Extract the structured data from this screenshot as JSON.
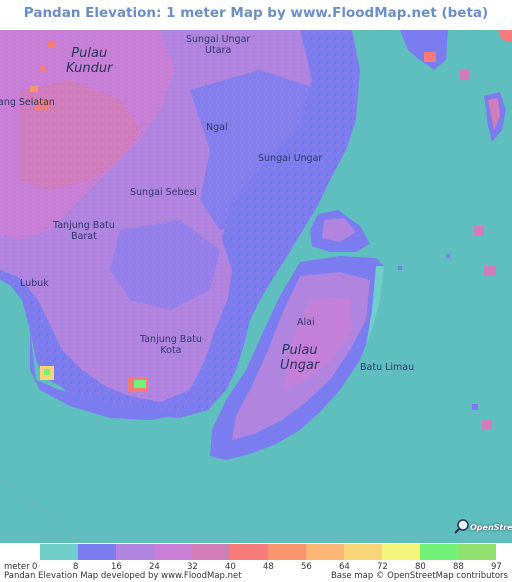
{
  "title": "Pandan Elevation: 1 meter Map by www.FloodMap.net (beta)",
  "map_labels": {
    "pulau_kundur": "Pulau\nKundur",
    "sungai_ungar_utara": "Sungai Ungar\nUtara",
    "selatan": "ang Selatan",
    "ngal": "Ngal",
    "sungai_ungar": "Sungai Ungar",
    "sungai_sebesi": "Sungai Sebesi",
    "tanjung_batu_barat": "Tanjung Batu\nBarat",
    "lubuk": "Lubuk",
    "tanjung_batu_kota": "Tanjung Batu\nKota",
    "alai": "Alai",
    "pulau_ungar": "Pulau\nUngar",
    "batu_limau": "Batu Limau"
  },
  "legend": {
    "unit": "meter",
    "ticks": [
      "0",
      "8",
      "16",
      "24",
      "32",
      "40",
      "48",
      "56",
      "64",
      "72",
      "80",
      "88",
      "97"
    ],
    "colors": [
      "#6fcfc8",
      "#7a7cf0",
      "#b184e0",
      "#c97fd6",
      "#d27db7",
      "#f87b7b",
      "#fa9570",
      "#fcb676",
      "#f9d57a",
      "#f4f57a",
      "#73f27a",
      "#91e070"
    ]
  },
  "colors": {
    "water": "#5fbfbf",
    "low_land": "#7a7cf0",
    "mid_land": "#b184e0",
    "high_land": "#d27db7",
    "peak": "#f87b7b",
    "top": "#73f27a"
  },
  "osm_badge": "OpenStreetMap",
  "footer": {
    "left": "Pandan Elevation Map developed by www.FloodMap.net",
    "right": "Base map © OpenStreetMap contributors"
  }
}
